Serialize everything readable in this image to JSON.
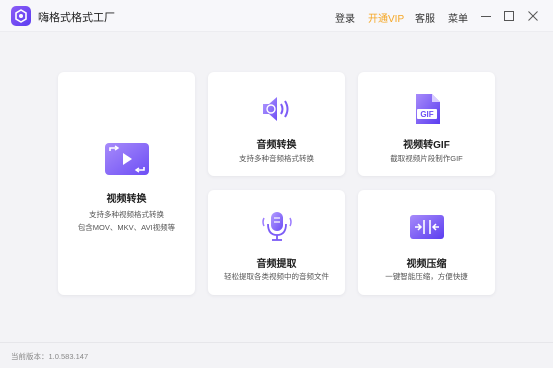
{
  "app": {
    "title": "嗨格式格式工厂",
    "logo_icon": "app-logo-icon"
  },
  "header": {
    "login_label": "登录",
    "vip_label": "开通VIP",
    "service_label": "客服",
    "menu_label": "菜单",
    "vip_color": "#f5a623"
  },
  "cards": {
    "video_convert": {
      "title": "视频转换",
      "desc_line1": "支持多种视频格式转换",
      "desc_line2": "包含MOV、MKV、AVI视频等",
      "icon": "video-convert-icon"
    },
    "audio_convert": {
      "title": "音频转换",
      "desc": "支持多种音频格式转换",
      "icon": "audio-convert-icon"
    },
    "video_to_gif": {
      "title": "视频转GIF",
      "desc": "截取视频片段制作GIF",
      "icon": "gif-icon",
      "badge": "GIF"
    },
    "audio_extract": {
      "title": "音频提取",
      "desc": "轻松提取各类视频中的音频文件",
      "icon": "microphone-icon"
    },
    "video_compress": {
      "title": "视频压缩",
      "desc": "一键智能压缩，方便快捷",
      "icon": "video-compress-icon"
    }
  },
  "footer": {
    "version": "当前版本：1.0.583.147"
  },
  "colors": {
    "accent": "#6d4ef5",
    "accent_light": "#9b7bff",
    "background": "#f3f3f6"
  }
}
